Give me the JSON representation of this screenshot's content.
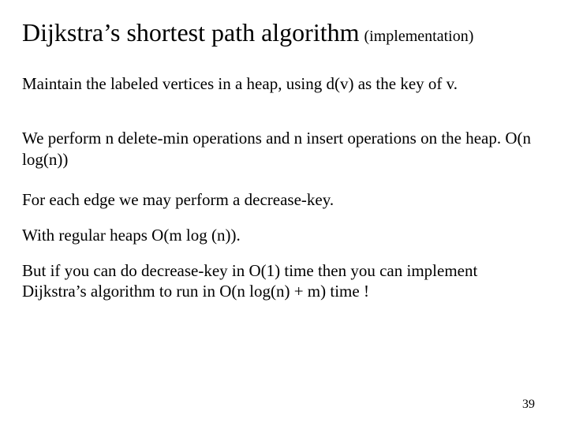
{
  "title": "Dijkstra’s shortest path algorithm",
  "subtitle": "(implementation)",
  "paragraphs": {
    "p1": "Maintain the labeled vertices in a heap, using d(v) as the key of v.",
    "p2": "We perform n delete-min operations and n insert operations on the heap. O(n log(n))",
    "p3": "For each edge we may perform a decrease-key.",
    "p4": "With regular heaps O(m log (n)).",
    "p5": "But if you can do decrease-key in O(1) time then you can implement Dijkstra’s algorithm to run in O(n log(n) + m) time !"
  },
  "page_number": "39"
}
